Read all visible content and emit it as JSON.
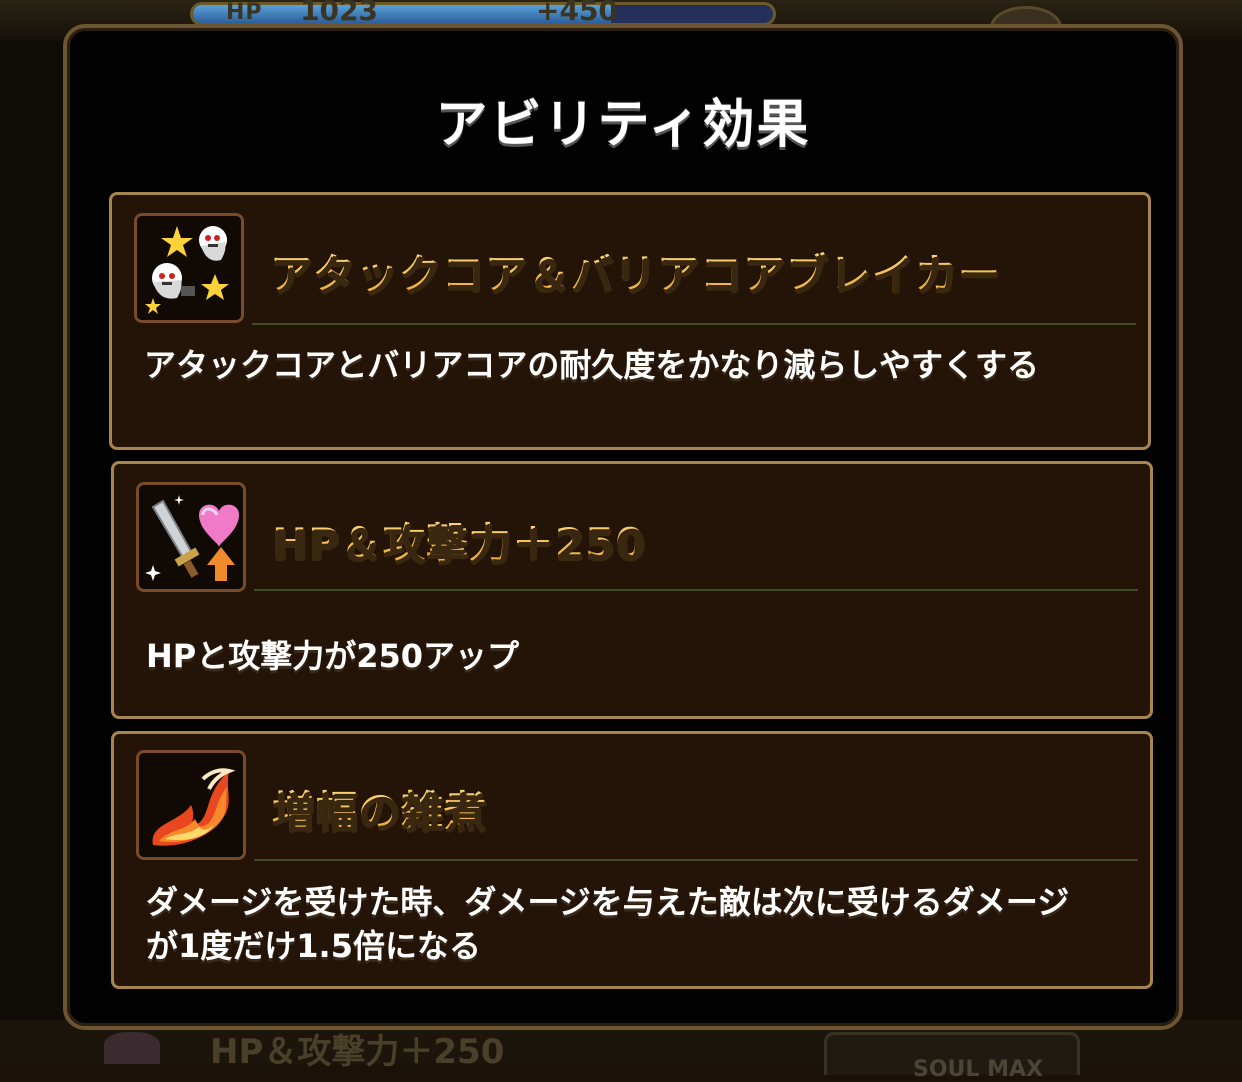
{
  "background": {
    "hp_label": "HP",
    "hp_value": "1023",
    "hp_bonus": "+450",
    "hp_fill_fraction": 0.72,
    "bottom_ability_text": "HP＆攻撃力＋250",
    "bottom_button_label": "SOUL MAX"
  },
  "modal": {
    "title": "アビリティ効果",
    "abilities": [
      {
        "name": "アタックコア＆バリアコアブレイカー",
        "description": "アタックコアとバリアコアの耐久度をかなり減らしやすくする",
        "icon": "ghost-core-break-icon"
      },
      {
        "name": "HP＆攻撃力＋250",
        "description": "HPと攻撃力が250アップ",
        "icon": "sword-heart-up-icon"
      },
      {
        "name": "増幅の雑煮",
        "description": "ダメージを受けた時、ダメージを与えた敵は次に受けるダメージが1度だけ1.5倍になる",
        "icon": "flame-icon"
      }
    ]
  },
  "colors": {
    "title_text": "#ffffff",
    "ability_name": "#f4c24a",
    "card_border": "#a7854f",
    "card_background": "#241307",
    "modal_border": "#6e5531"
  }
}
